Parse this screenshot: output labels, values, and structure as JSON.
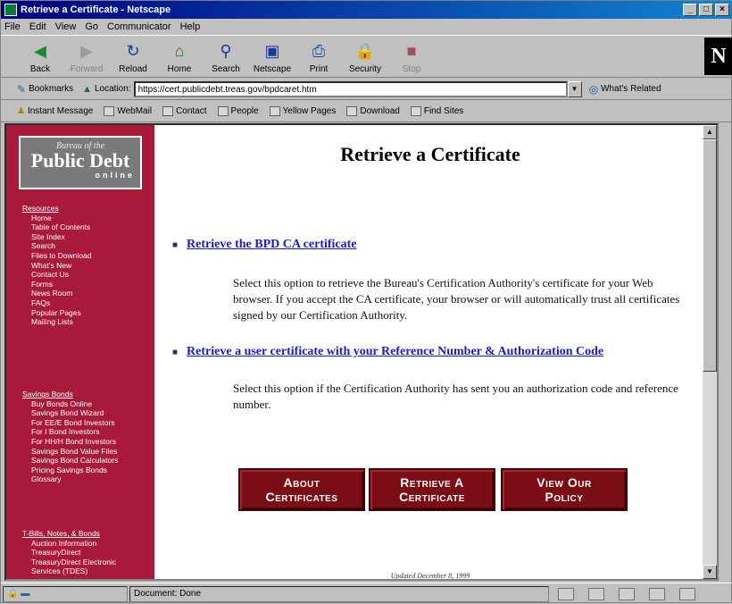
{
  "window": {
    "title": "Retrieve a Certificate - Netscape"
  },
  "menu": [
    "File",
    "Edit",
    "View",
    "Go",
    "Communicator",
    "Help"
  ],
  "toolbar": {
    "back": "Back",
    "forward": "Forward",
    "reload": "Reload",
    "home": "Home",
    "search": "Search",
    "netscape": "Netscape",
    "print": "Print",
    "security": "Security",
    "stop": "Stop"
  },
  "location": {
    "bookmarks": "Bookmarks",
    "label": "Location:",
    "url": "https://cert.publicdebt.treas.gov/bpdcaret.htm",
    "related": "What's Related"
  },
  "personal": {
    "instant_message": "Instant Message",
    "webmail": "WebMail",
    "contact": "Contact",
    "people": "People",
    "yellow_pages": "Yellow Pages",
    "download": "Download",
    "find_sites": "Find Sites"
  },
  "logo": {
    "top": "Bureau of the",
    "main": "Public Debt",
    "sub": "online"
  },
  "sidebar": {
    "resources": {
      "heading": "Resources",
      "items": [
        "Home",
        "Table of Contents",
        "Site Index",
        "Search",
        "Files to Download",
        "What's New",
        "Contact Us",
        "Forms",
        "News Room",
        "FAQs",
        "Popular Pages",
        "Mailing Lists"
      ]
    },
    "savings": {
      "heading": "Savings Bonds",
      "items": [
        "Buy Bonds Online",
        "Savings Bond Wizard",
        "For EE/E Bond Investors",
        "For I Bond Investors",
        "For HH/H Bond Investors",
        "Savings Bond Value Files",
        "Savings Bond Calculators",
        "Pricing Savings Bonds",
        "Glossary"
      ]
    },
    "tbills": {
      "heading": "T-Bills, Notes, & Bonds",
      "items": [
        "Auction Information",
        "TreasuryDirect",
        "TreasuryDirect Electronic",
        "Services (TDES)"
      ]
    }
  },
  "main": {
    "title": "Retrieve a Certificate",
    "link1": "Retrieve the BPD CA certificate",
    "desc1": "Select this option to retrieve the Bureau's Certification Authority's certificate for your Web browser. If you accept the CA certificate, your browser or will automatically trust all certificates signed by our Certification Authority.",
    "link2": "Retrieve a user certificate with your Reference Number & Authorization Code",
    "desc2": "Select this option if the Certification Authority has sent you an authorization code and reference number.",
    "buttons": {
      "about": [
        "About",
        "Certificates"
      ],
      "retrieve": [
        "Retrieve A",
        "Certificate"
      ],
      "policy": [
        "View Our",
        "Policy"
      ]
    },
    "updated": "Updated December 8, 1999"
  },
  "status": {
    "text": "Document: Done"
  }
}
